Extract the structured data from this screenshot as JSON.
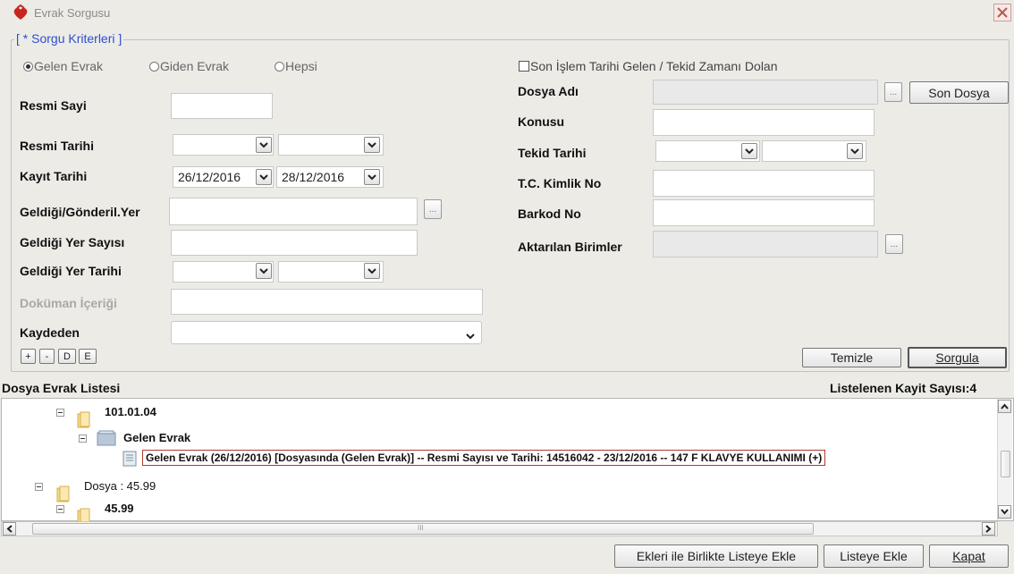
{
  "window": {
    "title": "Evrak Sorgusu"
  },
  "criteria": {
    "group_title": "[ * Sorgu Kriterleri ]",
    "radio_options": [
      {
        "label": "Gelen Evrak",
        "selected": true
      },
      {
        "label": "Giden Evrak",
        "selected": false
      },
      {
        "label": "Hepsi",
        "selected": false
      }
    ],
    "son_islem_checkbox": "Son İşlem Tarihi Gelen / Tekid Zamanı Dolan",
    "left": {
      "resmi_sayi": "Resmi Sayi",
      "resmi_tarihi": "Resmi Tarihi",
      "kayit_tarihi": "Kayıt Tarihi",
      "kayit_tarihi_from": "26/12/2016",
      "kayit_tarihi_to": "28/12/2016",
      "geldigi_yer": "Geldiği/Gönderil.Yer",
      "geldigi_yer_sayisi": "Geldiği Yer Sayısı",
      "geldigi_yer_tarihi": "Geldiği Yer Tarihi",
      "dokuman_icerigi": "Doküman İçeriği",
      "kaydeden": "Kaydeden"
    },
    "right": {
      "dosya_adi": "Dosya Adı",
      "son_dosya_button": "Son Dosya",
      "konusu": "Konusu",
      "tekid_tarihi": "Tekid Tarihi",
      "tc_kimlik_no": "T.C. Kimlik No",
      "barkod_no": "Barkod No",
      "aktarilan_birimler": "Aktarılan Birimler"
    },
    "small_buttons": [
      "+",
      "-",
      "D",
      "E"
    ],
    "ellipsis": "...",
    "temizle_button": "Temizle",
    "sorgula_button": "Sorgula"
  },
  "list": {
    "title": "Dosya Evrak Listesi",
    "count_label": "Listelenen Kayit Sayısı:4",
    "nodes": [
      {
        "label": "101.01.04"
      },
      {
        "label": "Gelen Evrak"
      },
      {
        "label": "Gelen Evrak (26/12/2016) [Dosyasında (Gelen Evrak)] -- Resmi Sayısı ve Tarihi: 14516042 - 23/12/2016 -- 147 F KLAVYE KULLANIMI (+)"
      },
      {
        "label": "Dosya : 45.99"
      },
      {
        "label": "45.99"
      }
    ],
    "scroll_grip": "III"
  },
  "footer": {
    "ekleri_button": "Ekleri ile Birlikte Listeye Ekle",
    "listeye_ekle_button": "Listeye Ekle",
    "kapat_button": "Kapat"
  }
}
